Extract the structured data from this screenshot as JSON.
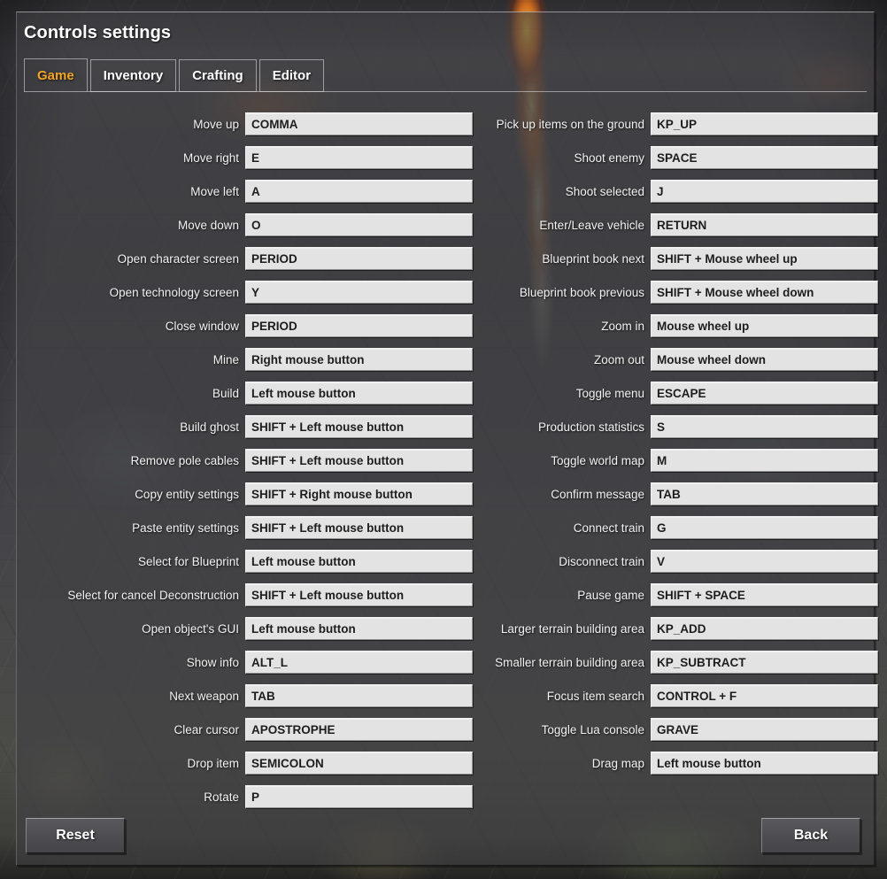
{
  "window": {
    "title": "Controls settings"
  },
  "tabs": [
    {
      "label": "Game",
      "active": true
    },
    {
      "label": "Inventory",
      "active": false
    },
    {
      "label": "Crafting",
      "active": false
    },
    {
      "label": "Editor",
      "active": false
    }
  ],
  "colors": {
    "accent_active_tab": "#f5a623",
    "panel_bg": "#404044",
    "field_bg": "#e3e3e3",
    "field_text": "#1d1d1d",
    "label_text": "#f2f2f2"
  },
  "bindings": {
    "left_column": [
      {
        "label": "Move up",
        "value": "COMMA"
      },
      {
        "label": "Move right",
        "value": "E"
      },
      {
        "label": "Move left",
        "value": "A"
      },
      {
        "label": "Move down",
        "value": "O"
      },
      {
        "label": "Open character screen",
        "value": "PERIOD"
      },
      {
        "label": "Open technology screen",
        "value": "Y"
      },
      {
        "label": "Close window",
        "value": "PERIOD"
      },
      {
        "label": "Mine",
        "value": "Right mouse button"
      },
      {
        "label": "Build",
        "value": "Left mouse button"
      },
      {
        "label": "Build ghost",
        "value": "SHIFT + Left mouse button"
      },
      {
        "label": "Remove pole cables",
        "value": "SHIFT + Left mouse button"
      },
      {
        "label": "Copy entity settings",
        "value": "SHIFT + Right mouse button"
      },
      {
        "label": "Paste entity settings",
        "value": "SHIFT + Left mouse button"
      },
      {
        "label": "Select for Blueprint",
        "value": "Left mouse button"
      },
      {
        "label": "Select for cancel Deconstruction",
        "value": "SHIFT + Left mouse button"
      },
      {
        "label": "Open object's GUI",
        "value": "Left mouse button"
      },
      {
        "label": "Show info",
        "value": "ALT_L"
      },
      {
        "label": "Next weapon",
        "value": "TAB"
      },
      {
        "label": "Clear cursor",
        "value": "APOSTROPHE"
      },
      {
        "label": "Drop item",
        "value": "SEMICOLON"
      },
      {
        "label": "Rotate",
        "value": "P"
      }
    ],
    "right_column": [
      {
        "label": "Pick up items on the ground",
        "value": "KP_UP"
      },
      {
        "label": "Shoot enemy",
        "value": "SPACE"
      },
      {
        "label": "Shoot selected",
        "value": "J"
      },
      {
        "label": "Enter/Leave vehicle",
        "value": "RETURN"
      },
      {
        "label": "Blueprint book next",
        "value": "SHIFT + Mouse wheel up"
      },
      {
        "label": "Blueprint book previous",
        "value": "SHIFT + Mouse wheel down"
      },
      {
        "label": "Zoom in",
        "value": "Mouse wheel up"
      },
      {
        "label": "Zoom out",
        "value": "Mouse wheel down"
      },
      {
        "label": "Toggle menu",
        "value": "ESCAPE"
      },
      {
        "label": "Production statistics",
        "value": "S"
      },
      {
        "label": "Toggle world map",
        "value": "M"
      },
      {
        "label": "Confirm message",
        "value": "TAB"
      },
      {
        "label": "Connect train",
        "value": "G"
      },
      {
        "label": "Disconnect train",
        "value": "V"
      },
      {
        "label": "Pause game",
        "value": "SHIFT + SPACE"
      },
      {
        "label": "Larger terrain building area",
        "value": "KP_ADD"
      },
      {
        "label": "Smaller terrain building area",
        "value": "KP_SUBTRACT"
      },
      {
        "label": "Focus item search",
        "value": "CONTROL + F"
      },
      {
        "label": "Toggle Lua console",
        "value": "GRAVE"
      },
      {
        "label": "Drag map",
        "value": "Left mouse button"
      }
    ]
  },
  "footer": {
    "reset_label": "Reset",
    "back_label": "Back"
  }
}
